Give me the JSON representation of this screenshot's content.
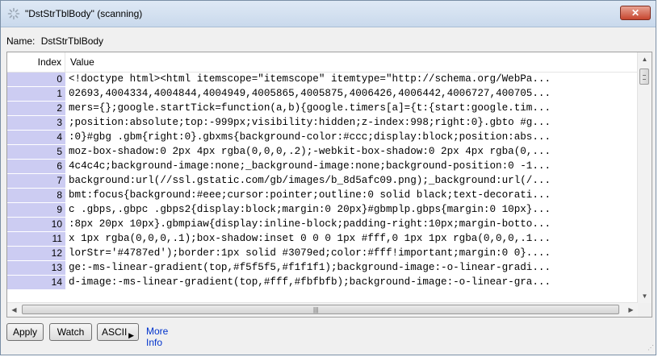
{
  "window": {
    "title": "\"DstStrTblBody\" (scanning)",
    "close_label": "✕"
  },
  "name_field": {
    "label": "Name:",
    "value": "DstStrTblBody"
  },
  "table": {
    "columns": [
      "Index",
      "Value"
    ],
    "rows": [
      {
        "index": "0",
        "value": "<!doctype html><html itemscope=\"itemscope\" itemtype=\"http://schema.org/WebPa..."
      },
      {
        "index": "1",
        "value": "02693,4004334,4004844,4004949,4005865,4005875,4006426,4006442,4006727,400705..."
      },
      {
        "index": "2",
        "value": "mers={};google.startTick=function(a,b){google.timers[a]={t:{start:google.tim..."
      },
      {
        "index": "3",
        "value": ";position:absolute;top:-999px;visibility:hidden;z-index:998;right:0}.gbto #g..."
      },
      {
        "index": "4",
        "value": ":0}#gbg .gbm{right:0}.gbxms{background-color:#ccc;display:block;position:abs..."
      },
      {
        "index": "5",
        "value": "moz-box-shadow:0 2px 4px rgba(0,0,0,.2);-webkit-box-shadow:0 2px 4px rgba(0,..."
      },
      {
        "index": "6",
        "value": "4c4c4c;background-image:none;_background-image:none;background-position:0 -1..."
      },
      {
        "index": "7",
        "value": "background:url(//ssl.gstatic.com/gb/images/b_8d5afc09.png);_background:url(/..."
      },
      {
        "index": "8",
        "value": "bmt:focus{background:#eee;cursor:pointer;outline:0 solid black;text-decorati..."
      },
      {
        "index": "9",
        "value": "c .gbps,.gbpc .gbps2{display:block;margin:0 20px}#gbmplp.gbps{margin:0 10px}..."
      },
      {
        "index": "10",
        "value": ":8px 20px 10px}.gbmpiaw{display:inline-block;padding-right:10px;margin-botto..."
      },
      {
        "index": "11",
        "value": "x 1px rgba(0,0,0,.1);box-shadow:inset 0 0 0 1px #fff,0 1px 1px rgba(0,0,0,.1..."
      },
      {
        "index": "12",
        "value": "lorStr='#4787ed');border:1px solid #3079ed;color:#fff!important;margin:0 0}...."
      },
      {
        "index": "13",
        "value": "ge:-ms-linear-gradient(top,#f5f5f5,#f1f1f1);background-image:-o-linear-gradi..."
      },
      {
        "index": "14",
        "value": "d-image:-ms-linear-gradient(top,#fff,#fbfbfb);background-image:-o-linear-gra..."
      }
    ]
  },
  "buttons": {
    "apply": "Apply",
    "watch": "Watch",
    "ascii": "ASCII",
    "more_info": "More Info"
  },
  "colors": {
    "index_cell_bg": "#ccccf2",
    "link": "#0033cc",
    "close_button": "#c7462f"
  }
}
